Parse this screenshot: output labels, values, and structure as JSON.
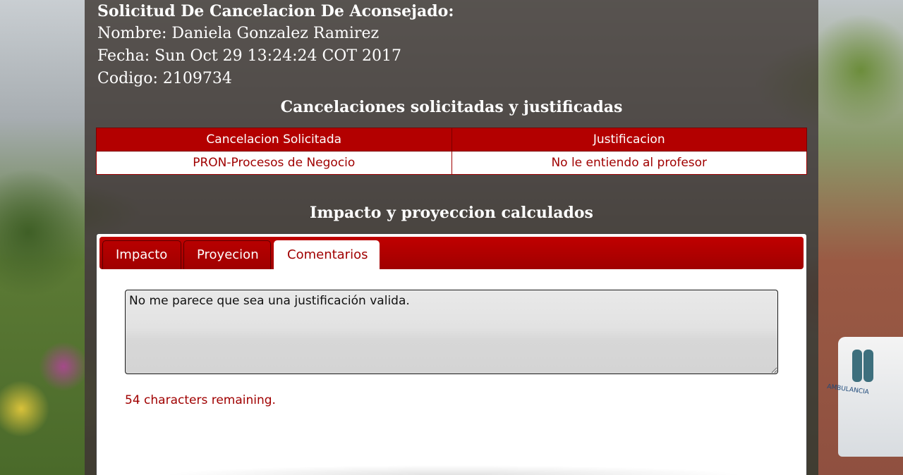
{
  "request": {
    "heading": "Solicitud De Cancelacion De Aconsejado:",
    "nombre": "Nombre: Daniela Gonzalez Ramirez",
    "fecha": "Fecha: Sun Oct 29 13:24:24 COT 2017",
    "codigo": "Codigo: 2109734"
  },
  "cancelaciones": {
    "title": "Cancelaciones solicitadas y justificadas",
    "columns": [
      "Cancelacion Solicitada",
      "Justificacion"
    ],
    "rows": [
      [
        "PRON-Procesos de Negocio",
        "No le entiendo al profesor"
      ]
    ]
  },
  "impacto": {
    "title": "Impacto y proyeccion calculados",
    "tabs": [
      "Impacto",
      "Proyecion",
      "Comentarios"
    ],
    "active_tab": "Comentarios",
    "comment_value": "No me parece que sea una justificación valida.",
    "remaining": "54 characters remaining."
  },
  "background_extra_text": "AMBULANCIA",
  "colors": {
    "accent_red": "#b30000",
    "text_red": "#a00000",
    "panel_overlay": "rgba(60,52,48,0.78)"
  }
}
